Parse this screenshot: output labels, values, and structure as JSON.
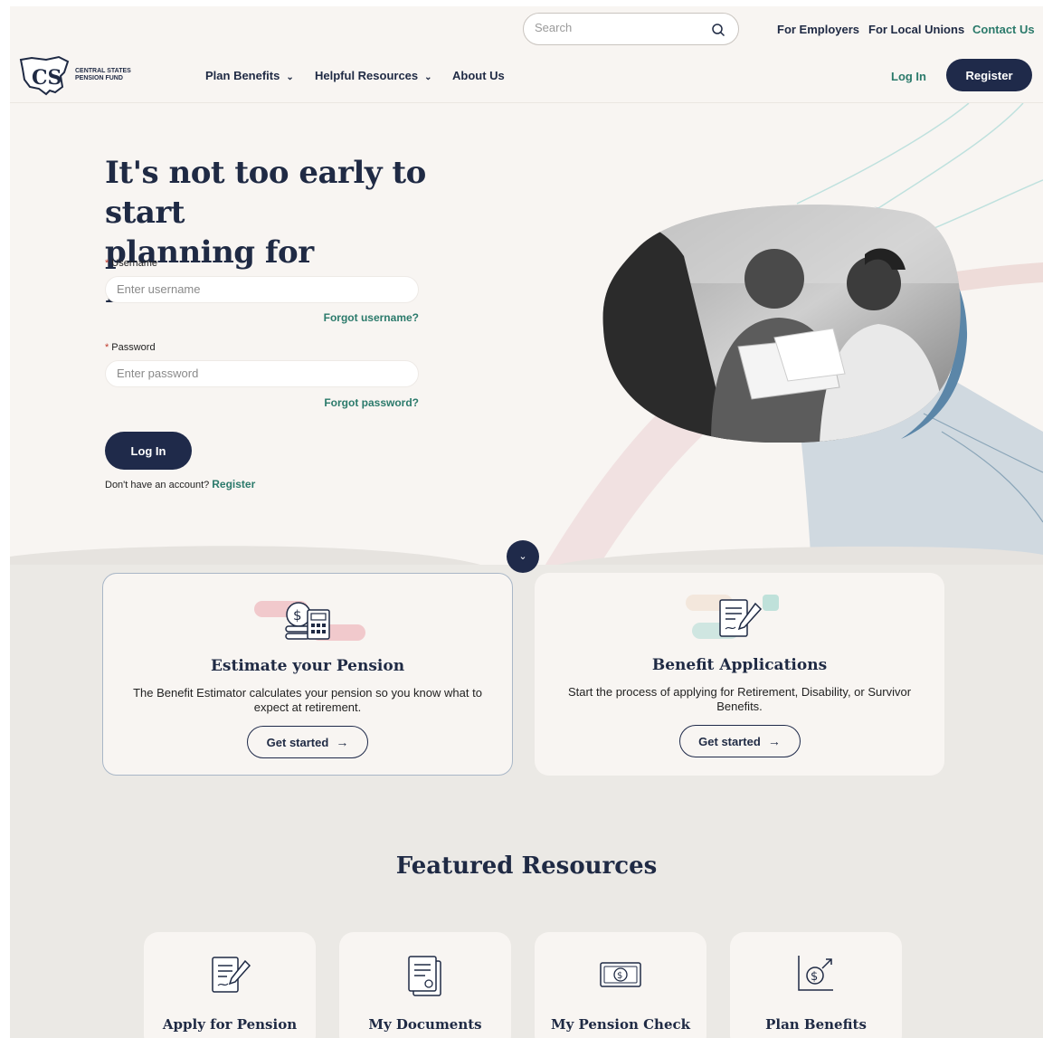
{
  "header": {
    "search_placeholder": "Search",
    "util_links": [
      "For Employers",
      "For Local Unions",
      "Contact Us"
    ],
    "logo_text_line1": "CENTRAL STATES",
    "logo_text_line2": "PENSION FUND",
    "logo_monogram": "CS",
    "nav": [
      "Plan Benefits",
      "Helpful Resources",
      "About Us"
    ],
    "login_label": "Log In",
    "register_label": "Register"
  },
  "hero": {
    "title_line1": "It's not too early to start",
    "title_line2": "planning for retirement",
    "username_label": "Username",
    "username_placeholder": "Enter username",
    "forgot_username": "Forgot username?",
    "password_label": "Password",
    "password_placeholder": "Enter password",
    "forgot_password": "Forgot password?",
    "login_button": "Log In",
    "no_account_text": "Don't have an account?",
    "register_link": "Register",
    "required_marker": "*"
  },
  "cards": [
    {
      "title": "Estimate your Pension",
      "description": "The Benefit Estimator calculates your pension so you know what to expect at retirement.",
      "button": "Get started",
      "icon": "calculator-coin-icon"
    },
    {
      "title": "Benefit Applications",
      "description": "Start the process of applying for Retirement, Disability, or Survivor Benefits.",
      "button": "Get started",
      "icon": "document-pen-icon"
    }
  ],
  "featured": {
    "title": "Featured Resources",
    "items": [
      {
        "label": "Apply for Pension",
        "icon": "document-pen-icon"
      },
      {
        "label": "My Documents",
        "icon": "documents-icon"
      },
      {
        "label": "My Pension Check",
        "icon": "dollar-bill-icon"
      },
      {
        "label": "Plan Benefits",
        "icon": "dollar-growth-icon"
      }
    ]
  },
  "colors": {
    "navy": "#1f2a4a",
    "teal": "#2b7a6b",
    "page_bg": "#f8f5f2",
    "section_bg": "#ebe9e5",
    "steel_blue": "#5b86a8"
  }
}
